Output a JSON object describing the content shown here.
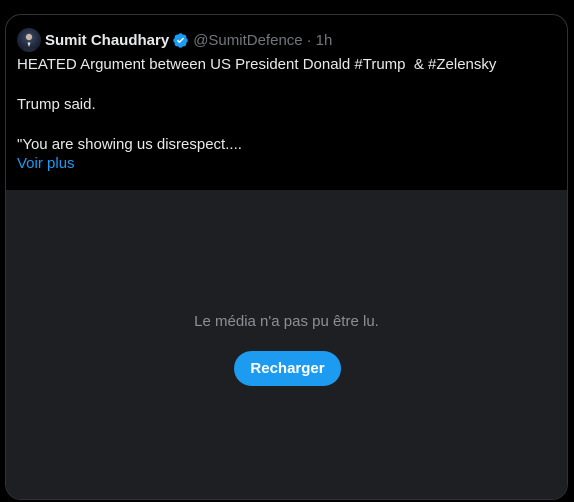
{
  "tweet": {
    "author_name": "Sumit Chaudhary",
    "handle": "@SumitDefence",
    "separator": "·",
    "time": "1h",
    "lines": [
      "HEATED Argument between US President Donald #Trump  & #Zelensky",
      "Trump said.",
      "\"You are showing us disrespect...."
    ],
    "show_more": "Voir plus"
  },
  "media": {
    "error_message": "Le média n'a pas pu être lu.",
    "reload_label": "Recharger"
  },
  "icons": {
    "avatar": "avatar-icon",
    "verified": "verified-badge-icon"
  },
  "colors": {
    "background": "#000000",
    "text": "#e7e9ea",
    "secondary": "#71767b",
    "accent": "#1d9bf0",
    "media_background": "#1e1f23"
  }
}
